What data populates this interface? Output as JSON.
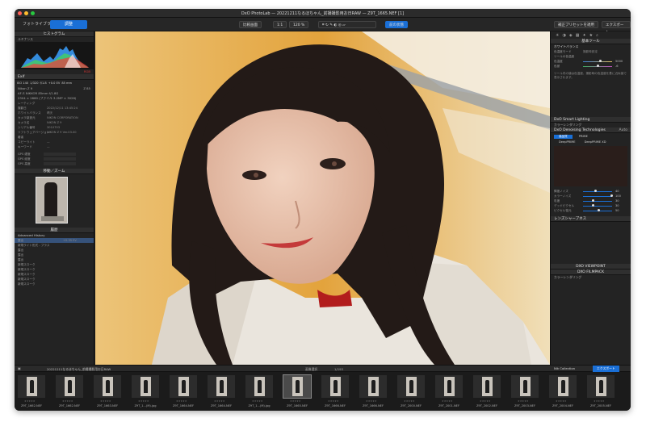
{
  "window": {
    "title": "DxO PhotoLab — 20221211なるほちゃん_前撮撮影用お日RAW — Z9T_1665.NEF [1]"
  },
  "toolbar": {
    "tab_library": "フォトライブラリ",
    "tab_customize": "調整",
    "compare": "比較画面",
    "zoom": "120 %",
    "zoom_fit": "1:1",
    "preset_apply": "補正プリセットを適用",
    "export": "エクスポート",
    "before_after": "前の状態"
  },
  "left": {
    "histogram": {
      "title": "ヒストグラム",
      "channel": "ルミナンス",
      "rgb_label": "RGB"
    },
    "exif": {
      "title": "Exif",
      "iso": "ISO 140",
      "shutter": "1/320",
      "aperture": "f/1.8",
      "ev": "+0.0 EV",
      "focal": "85 mm",
      "camera": "Nikon Z 9",
      "lens_short": "Z 85",
      "lens": "AF-S NIKKOR 85mm f/1.8G",
      "size": "2304 × 2880 (ファイル 3.2MP × 3026)"
    },
    "meta": [
      {
        "k": "レーティング",
        "v": ""
      },
      {
        "k": "撮影日",
        "v": "2022/12/11 13:45:24"
      },
      {
        "k": "ホワイトバランス",
        "v": "晴天"
      },
      {
        "k": "カメラ製造元",
        "v": "NIKON CORPORATION"
      },
      {
        "k": "カメラ名",
        "v": "NIKON Z 9"
      },
      {
        "k": "シリアル番号",
        "v": "3010793"
      },
      {
        "k": "ソフトウェアバージョン",
        "v": "NIKON Z 9 Ver.03.00"
      },
      {
        "k": "著者",
        "v": ""
      },
      {
        "k": "コピーライト",
        "v": "—"
      },
      {
        "k": "キーワード",
        "v": "—"
      }
    ],
    "gps": [
      "GPS 緯度",
      "GPS 経度",
      "GPS 高度"
    ],
    "navigator_title": "移動／ズーム",
    "history": {
      "title": "履歴",
      "group": "Advanced History",
      "items": [
        {
          "label": "露出",
          "v": "+0.35 EV"
        },
        {
          "label": "新規ライト形式 - プラス",
          "v": ""
        },
        {
          "label": "露出",
          "v": ""
        },
        {
          "label": "露出",
          "v": ""
        },
        {
          "label": "露出",
          "v": ""
        },
        {
          "label": "新規スローク",
          "v": ""
        },
        {
          "label": "新規スローク",
          "v": ""
        },
        {
          "label": "新規スローク",
          "v": ""
        },
        {
          "label": "新規スローク",
          "v": ""
        },
        {
          "label": "新規スローク",
          "v": ""
        }
      ]
    }
  },
  "right": {
    "basic_tools": "基本ツール",
    "wb": {
      "title": "ホワイトバランス",
      "mode_label": "色温度モード",
      "mode_value": "撮影時設定",
      "picker": "ツールの色温度",
      "temp_label": "色温度",
      "temp_value": "5000",
      "tint_label": "色被",
      "tint_value": "-6"
    },
    "info_text": "ツール内の値は色温度、撮影時の色温度を基に近似値で表示されます。",
    "smartlighting": "DxO Smart Lighting",
    "colorrendering": "カラーレンダリング",
    "denoise": {
      "title": "DxO Denoising Technologies",
      "tab1": "高品質",
      "tab2": "PRIME",
      "tab3": "DeepPRIME",
      "tab4": "DeepPRIME XD"
    },
    "sliders": [
      {
        "label": "輝度ノイズ",
        "v": "40"
      },
      {
        "label": "カラーノイズ",
        "v": "100"
      },
      {
        "label": "彩度",
        "v": "30"
      },
      {
        "label": "デッドピクセル",
        "v": "30"
      },
      {
        "label": "ピクセル復元",
        "v": "50"
      }
    ],
    "lens_title": "レンズシャープネス",
    "viewpoint": "DXO VIEWPOINT",
    "filmpack": "DXO FILMPACK",
    "color_grading": "カラーレンダリング",
    "auto": "Auto"
  },
  "filmstrip": {
    "path": "20221211なるほちゃん_前撮撮影用お日RAW",
    "count": "1/193",
    "selection": "画像選択",
    "nik": "Nik Collection",
    "export": "エクスポート",
    "files": [
      "Z9T_1662.NEF",
      "Z9T_1662.NEF",
      "Z9T_1663.NEF",
      "Z9T_1...(M).jpg",
      "Z9T_1664.NEF",
      "Z9T_1664.NEF",
      "Z9T_1...(M).jpg",
      "Z9T_1665.NEF",
      "Z9T_1666.NEF",
      "Z9T_1666.NEF",
      "Z9T_2000.NEF",
      "Z9T_2001.NEF",
      "Z9T_2002.NEF",
      "Z9T_2003.NEF",
      "Z9T_2004.NEF",
      "Z9T_2005.NEF"
    ]
  },
  "colors": {
    "accent": "#1a6fd6",
    "panel": "#232323",
    "background": "#e9b04a"
  }
}
